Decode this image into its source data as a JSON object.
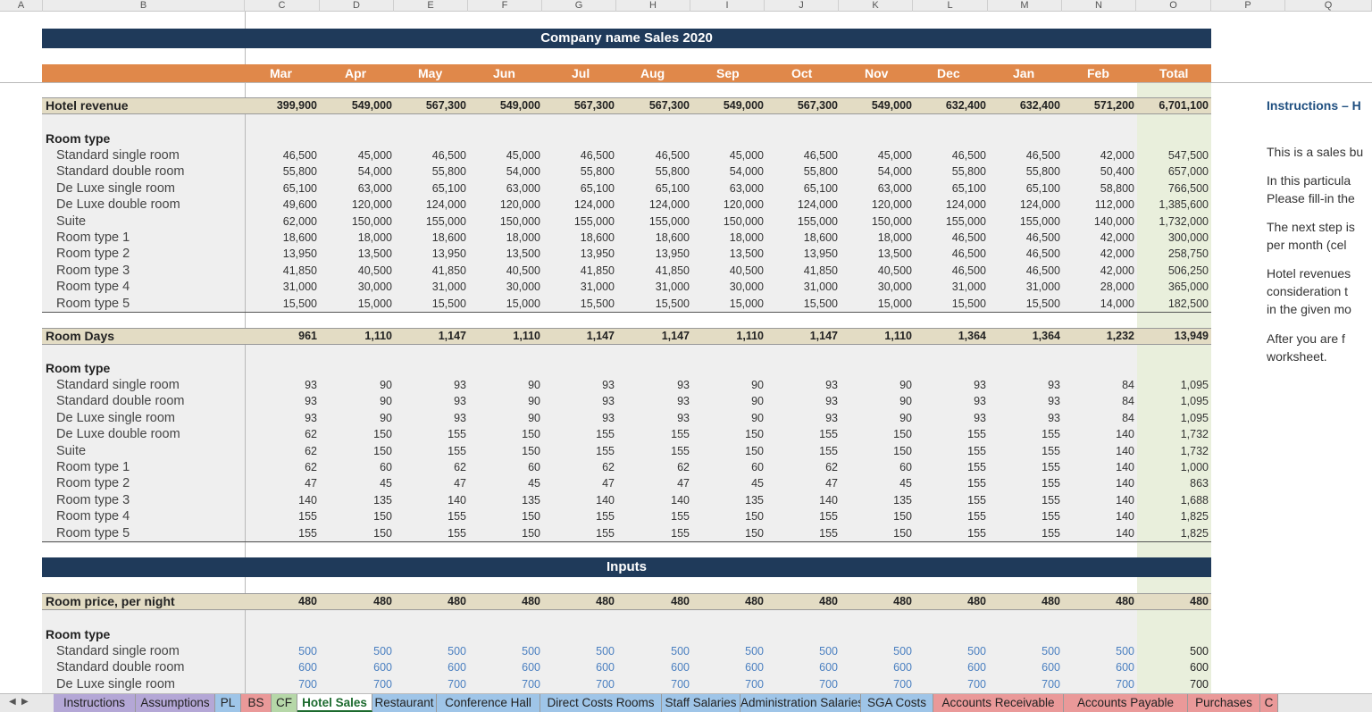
{
  "columns": [
    "A",
    "B",
    "C",
    "D",
    "E",
    "F",
    "G",
    "H",
    "I",
    "J",
    "K",
    "L",
    "M",
    "N",
    "O",
    "P",
    "Q"
  ],
  "title": "Company name Sales 2020",
  "months": [
    "Mar",
    "Apr",
    "May",
    "Jun",
    "Jul",
    "Aug",
    "Sep",
    "Oct",
    "Nov",
    "Dec",
    "Jan",
    "Feb",
    "Total"
  ],
  "room_types": [
    "Standard single room",
    "Standard double room",
    "De Luxe single room",
    "De Luxe double room",
    "Suite",
    "Room type 1",
    "Room type 2",
    "Room type 3",
    "Room type 4",
    "Room type 5"
  ],
  "section_label": "Room type",
  "hotel_revenue": {
    "label": "Hotel revenue",
    "totals": [
      "399,900",
      "549,000",
      "567,300",
      "549,000",
      "567,300",
      "567,300",
      "549,000",
      "567,300",
      "549,000",
      "632,400",
      "632,400",
      "571,200",
      "6,701,100"
    ],
    "rows": [
      [
        "46,500",
        "45,000",
        "46,500",
        "45,000",
        "46,500",
        "46,500",
        "45,000",
        "46,500",
        "45,000",
        "46,500",
        "46,500",
        "42,000",
        "547,500"
      ],
      [
        "55,800",
        "54,000",
        "55,800",
        "54,000",
        "55,800",
        "55,800",
        "54,000",
        "55,800",
        "54,000",
        "55,800",
        "55,800",
        "50,400",
        "657,000"
      ],
      [
        "65,100",
        "63,000",
        "65,100",
        "63,000",
        "65,100",
        "65,100",
        "63,000",
        "65,100",
        "63,000",
        "65,100",
        "65,100",
        "58,800",
        "766,500"
      ],
      [
        "49,600",
        "120,000",
        "124,000",
        "120,000",
        "124,000",
        "124,000",
        "120,000",
        "124,000",
        "120,000",
        "124,000",
        "124,000",
        "112,000",
        "1,385,600"
      ],
      [
        "62,000",
        "150,000",
        "155,000",
        "150,000",
        "155,000",
        "155,000",
        "150,000",
        "155,000",
        "150,000",
        "155,000",
        "155,000",
        "140,000",
        "1,732,000"
      ],
      [
        "18,600",
        "18,000",
        "18,600",
        "18,000",
        "18,600",
        "18,600",
        "18,000",
        "18,600",
        "18,000",
        "46,500",
        "46,500",
        "42,000",
        "300,000"
      ],
      [
        "13,950",
        "13,500",
        "13,950",
        "13,500",
        "13,950",
        "13,950",
        "13,500",
        "13,950",
        "13,500",
        "46,500",
        "46,500",
        "42,000",
        "258,750"
      ],
      [
        "41,850",
        "40,500",
        "41,850",
        "40,500",
        "41,850",
        "41,850",
        "40,500",
        "41,850",
        "40,500",
        "46,500",
        "46,500",
        "42,000",
        "506,250"
      ],
      [
        "31,000",
        "30,000",
        "31,000",
        "30,000",
        "31,000",
        "31,000",
        "30,000",
        "31,000",
        "30,000",
        "31,000",
        "31,000",
        "28,000",
        "365,000"
      ],
      [
        "15,500",
        "15,000",
        "15,500",
        "15,000",
        "15,500",
        "15,500",
        "15,000",
        "15,500",
        "15,000",
        "15,500",
        "15,500",
        "14,000",
        "182,500"
      ]
    ]
  },
  "room_days": {
    "label": "Room Days",
    "totals": [
      "961",
      "1,110",
      "1,147",
      "1,110",
      "1,147",
      "1,147",
      "1,110",
      "1,147",
      "1,110",
      "1,364",
      "1,364",
      "1,232",
      "13,949"
    ],
    "rows": [
      [
        "93",
        "90",
        "93",
        "90",
        "93",
        "93",
        "90",
        "93",
        "90",
        "93",
        "93",
        "84",
        "1,095"
      ],
      [
        "93",
        "90",
        "93",
        "90",
        "93",
        "93",
        "90",
        "93",
        "90",
        "93",
        "93",
        "84",
        "1,095"
      ],
      [
        "93",
        "90",
        "93",
        "90",
        "93",
        "93",
        "90",
        "93",
        "90",
        "93",
        "93",
        "84",
        "1,095"
      ],
      [
        "62",
        "150",
        "155",
        "150",
        "155",
        "155",
        "150",
        "155",
        "150",
        "155",
        "155",
        "140",
        "1,732"
      ],
      [
        "62",
        "150",
        "155",
        "150",
        "155",
        "155",
        "150",
        "155",
        "150",
        "155",
        "155",
        "140",
        "1,732"
      ],
      [
        "62",
        "60",
        "62",
        "60",
        "62",
        "62",
        "60",
        "62",
        "60",
        "155",
        "155",
        "140",
        "1,000"
      ],
      [
        "47",
        "45",
        "47",
        "45",
        "47",
        "47",
        "45",
        "47",
        "45",
        "155",
        "155",
        "140",
        "863"
      ],
      [
        "140",
        "135",
        "140",
        "135",
        "140",
        "140",
        "135",
        "140",
        "135",
        "155",
        "155",
        "140",
        "1,688"
      ],
      [
        "155",
        "150",
        "155",
        "150",
        "155",
        "155",
        "150",
        "155",
        "150",
        "155",
        "155",
        "140",
        "1,825"
      ],
      [
        "155",
        "150",
        "155",
        "150",
        "155",
        "155",
        "150",
        "155",
        "150",
        "155",
        "155",
        "140",
        "1,825"
      ]
    ]
  },
  "inputs_title": "Inputs",
  "room_price": {
    "label": "Room price, per night",
    "totals": [
      "480",
      "480",
      "480",
      "480",
      "480",
      "480",
      "480",
      "480",
      "480",
      "480",
      "480",
      "480",
      "480"
    ],
    "rows": [
      [
        "500",
        "500",
        "500",
        "500",
        "500",
        "500",
        "500",
        "500",
        "500",
        "500",
        "500",
        "500",
        "500"
      ],
      [
        "600",
        "600",
        "600",
        "600",
        "600",
        "600",
        "600",
        "600",
        "600",
        "600",
        "600",
        "600",
        "600"
      ],
      [
        "700",
        "700",
        "700",
        "700",
        "700",
        "700",
        "700",
        "700",
        "700",
        "700",
        "700",
        "700",
        "700"
      ]
    ]
  },
  "instructions": {
    "title": "Instructions – H",
    "lines": [
      "This is a sales bu",
      "In this particula",
      "Please fill-in the",
      "The next step is",
      "per month (cel",
      "Hotel revenues",
      "consideration t",
      "in the given mo",
      "After you are f",
      "worksheet."
    ]
  },
  "tabs": [
    {
      "label": "Instructions",
      "color": "#b4a7d6"
    },
    {
      "label": "Assumptions",
      "color": "#b4a7d6"
    },
    {
      "label": "PL",
      "color": "#9fc5e8"
    },
    {
      "label": "BS",
      "color": "#ea9999"
    },
    {
      "label": "CF",
      "color": "#b6d7a8"
    },
    {
      "label": "Hotel Sales",
      "color": "#ffffff"
    },
    {
      "label": "Restaurant",
      "color": "#9fc5e8"
    },
    {
      "label": "Conference Hall",
      "color": "#9fc5e8"
    },
    {
      "label": "Direct Costs Rooms",
      "color": "#9fc5e8"
    },
    {
      "label": "Staff Salaries",
      "color": "#9fc5e8"
    },
    {
      "label": "Administration Salaries",
      "color": "#9fc5e8"
    },
    {
      "label": "SGA Costs",
      "color": "#9fc5e8"
    },
    {
      "label": "Accounts Receivable",
      "color": "#ea9999"
    },
    {
      "label": "Accounts Payable",
      "color": "#ea9999"
    },
    {
      "label": "Purchases",
      "color": "#ea9999"
    },
    {
      "label": "C",
      "color": "#ea9999"
    }
  ],
  "nav_icons": [
    "scroll-left-icon",
    "scroll-right-icon"
  ],
  "colors": {
    "banner": "#1f3a5a",
    "month_band": "#e0884a",
    "summary_row": "#e3dcc4",
    "total_column": "#e9efdc",
    "input_value": "#4a7fc0"
  }
}
